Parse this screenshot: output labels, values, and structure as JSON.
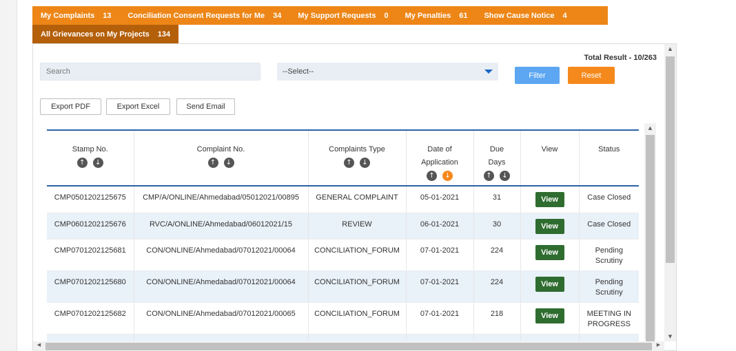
{
  "tabs": [
    {
      "label": "My Complaints",
      "count": "13"
    },
    {
      "label": "Conciliation Consent Requests for Me",
      "count": "34"
    },
    {
      "label": "My Support Requests",
      "count": "0"
    },
    {
      "label": "My Penalties",
      "count": "61"
    },
    {
      "label": "Show Cause Notice",
      "count": "4"
    }
  ],
  "active_tab": {
    "label": "All Grievances on My Projects",
    "count": "134"
  },
  "total_result": "Total Result - 10/263",
  "search": {
    "placeholder": "Search"
  },
  "select": {
    "value": "--Select--"
  },
  "buttons": {
    "filter": "Filter",
    "reset": "Reset",
    "export_pdf": "Export PDF",
    "export_excel": "Export Excel",
    "send_email": "Send Email"
  },
  "columns": {
    "stamp": "Stamp No.",
    "complaint": "Complaint No.",
    "type": "Complaints Type",
    "date_line1": "Date of",
    "date_line2": "Application",
    "due_line1": "Due",
    "due_line2": "Days",
    "view": "View",
    "status": "Status"
  },
  "rows": [
    {
      "stamp": "CMP0501202125675",
      "complaint": "CMP/A/ONLINE/Ahmedabad/05012021/00895",
      "type": "GENERAL COMPLAINT",
      "date": "05-01-2021",
      "due": "31",
      "view": "View",
      "status": "Case Closed"
    },
    {
      "stamp": "CMP0601202125676",
      "complaint": "RVC/A/ONLINE/Ahmedabad/06012021/15",
      "type": "REVIEW",
      "date": "06-01-2021",
      "due": "30",
      "view": "View",
      "status": "Case Closed"
    },
    {
      "stamp": "CMP0701202125681",
      "complaint": "CON/ONLINE/Ahmedabad/07012021/00064",
      "type": "CONCILIATION_FORUM",
      "date": "07-01-2021",
      "due": "224",
      "view": "View",
      "status": "Pending Scrutiny"
    },
    {
      "stamp": "CMP0701202125680",
      "complaint": "CON/ONLINE/Ahmedabad/07012021/00064",
      "type": "CONCILIATION_FORUM",
      "date": "07-01-2021",
      "due": "224",
      "view": "View",
      "status": "Pending Scrutiny"
    },
    {
      "stamp": "CMP0701202125682",
      "complaint": "CON/ONLINE/Ahmedabad/07012021/00065",
      "type": "CONCILIATION_FORUM",
      "date": "07-01-2021",
      "due": "218",
      "view": "View",
      "status": "MEETING IN PROGRESS"
    }
  ],
  "colors": {
    "tab_bar": "#ed8617",
    "active_tab": "#b45f0a",
    "view_button": "#2f6c30",
    "filter": "#5ca6f2",
    "reset": "#f5891c",
    "table_border": "#2a62a8"
  },
  "icons": {
    "sort_up": "arrow-up-circle-icon",
    "sort_down": "arrow-down-circle-icon",
    "dropdown": "caret-down-icon"
  }
}
